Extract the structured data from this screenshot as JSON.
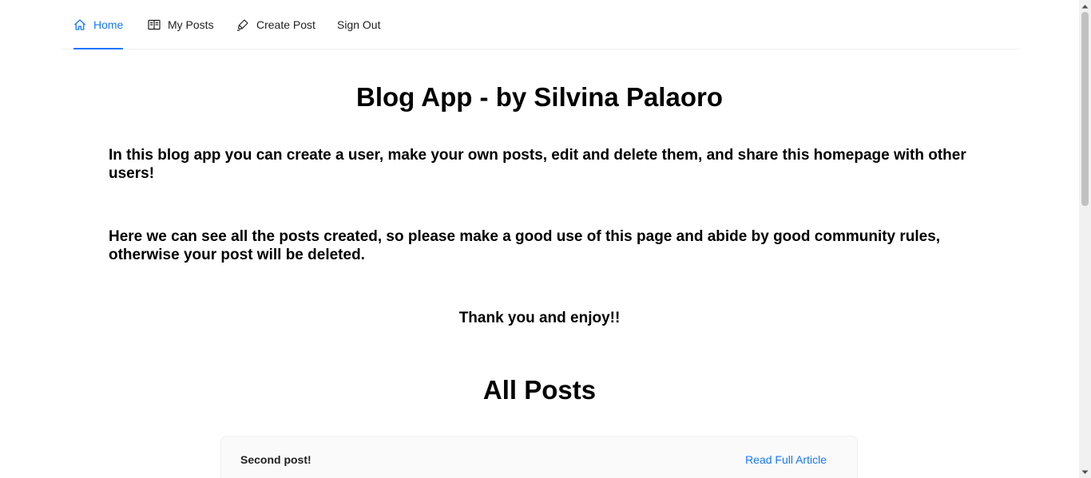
{
  "nav": {
    "items": [
      {
        "label": "Home",
        "icon": "home-icon",
        "active": true
      },
      {
        "label": "My Posts",
        "icon": "book-icon",
        "active": false
      },
      {
        "label": "Create Post",
        "icon": "highlighter-icon",
        "active": false
      },
      {
        "label": "Sign Out",
        "icon": "",
        "active": false
      }
    ]
  },
  "main": {
    "title": "Blog App - by Silvina Palaoro",
    "intro_1": "In this blog app you can create a user, make your own posts, edit and delete them, and share this homepage with other users!",
    "intro_2": "Here we can see all the posts created, so please make a good use of this page and abide by good community rules, otherwise your post will be deleted.",
    "thanks": "Thank you and enjoy!!",
    "posts_heading": "All Posts",
    "posts": [
      {
        "title": "Second post!",
        "link_label": "Read Full Article"
      }
    ]
  },
  "colors": {
    "accent": "#1677ff",
    "text": "#000000",
    "card_bg": "#fafafa"
  }
}
